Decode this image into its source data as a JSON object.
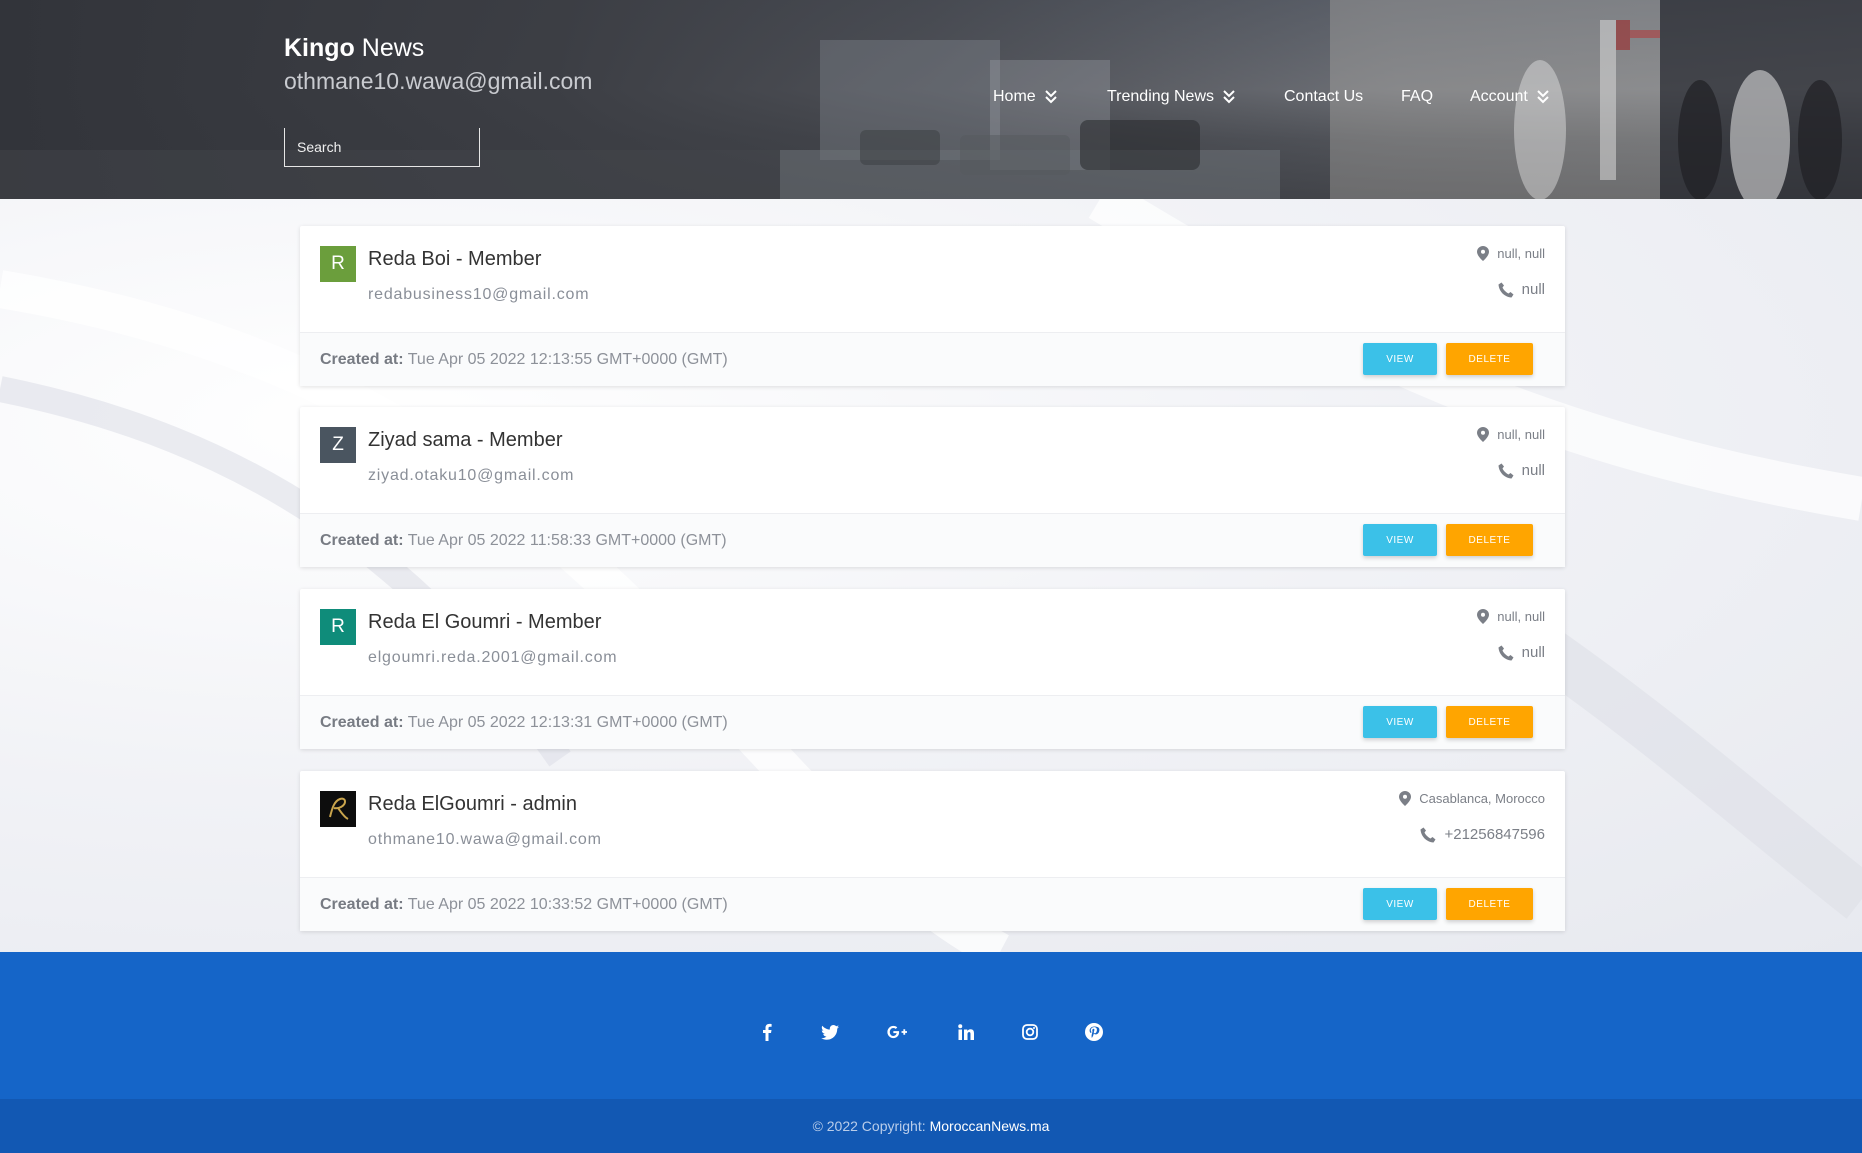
{
  "header": {
    "brand_bold": "Kingo",
    "brand_rest": "News",
    "user_email": "othmane10.wawa@gmail.com",
    "search_placeholder": "Search"
  },
  "nav": {
    "items": [
      {
        "label": "Home",
        "dropdown": true
      },
      {
        "label": "Trending News",
        "dropdown": true
      },
      {
        "label": "Contact Us",
        "dropdown": false
      },
      {
        "label": "FAQ",
        "dropdown": false
      },
      {
        "label": "Account",
        "dropdown": true
      }
    ]
  },
  "users": [
    {
      "avatar_letter": "R",
      "avatar_color": "#6b9e3c",
      "title": "Reda Boi - Member",
      "email": "redabusiness10@gmail.com",
      "location": "null, null",
      "phone": "null",
      "created_label": "Created at:",
      "created_value": "Tue Apr 05 2022 12:13:55 GMT+0000 (GMT)"
    },
    {
      "avatar_letter": "Z",
      "avatar_color": "#4a5560",
      "title": "Ziyad sama - Member",
      "email": "ziyad.otaku10@gmail.com",
      "location": "null, null",
      "phone": "null",
      "created_label": "Created at:",
      "created_value": "Tue Apr 05 2022 11:58:33 GMT+0000 (GMT)"
    },
    {
      "avatar_letter": "R",
      "avatar_color": "#0f8c7a",
      "title": "Reda El Goumri - Member",
      "email": "elgoumri.reda.2001@gmail.com",
      "location": "null, null",
      "phone": "null",
      "created_label": "Created at:",
      "created_value": "Tue Apr 05 2022 12:13:31 GMT+0000 (GMT)"
    },
    {
      "avatar_letter": "",
      "avatar_color": "#111111",
      "title": "Reda ElGoumri - admin",
      "email": "othmane10.wawa@gmail.com",
      "location": "Casablanca, Morocco",
      "phone": "+21256847596",
      "created_label": "Created at:",
      "created_value": "Tue Apr 05 2022 10:33:52 GMT+0000 (GMT)"
    }
  ],
  "buttons": {
    "view_label": "VIEW",
    "delete_label": "DELETE",
    "view_color": "#3bc1e8",
    "delete_color": "#ffa500"
  },
  "footer": {
    "social_icons": [
      "facebook-icon",
      "twitter-icon",
      "google-plus-icon",
      "linkedin-icon",
      "instagram-icon",
      "pinterest-icon"
    ],
    "copyright_prefix": "© 2022 Copyright:",
    "copyright_link": "MoroccanNews.ma",
    "bg_color": "#1565c8"
  }
}
